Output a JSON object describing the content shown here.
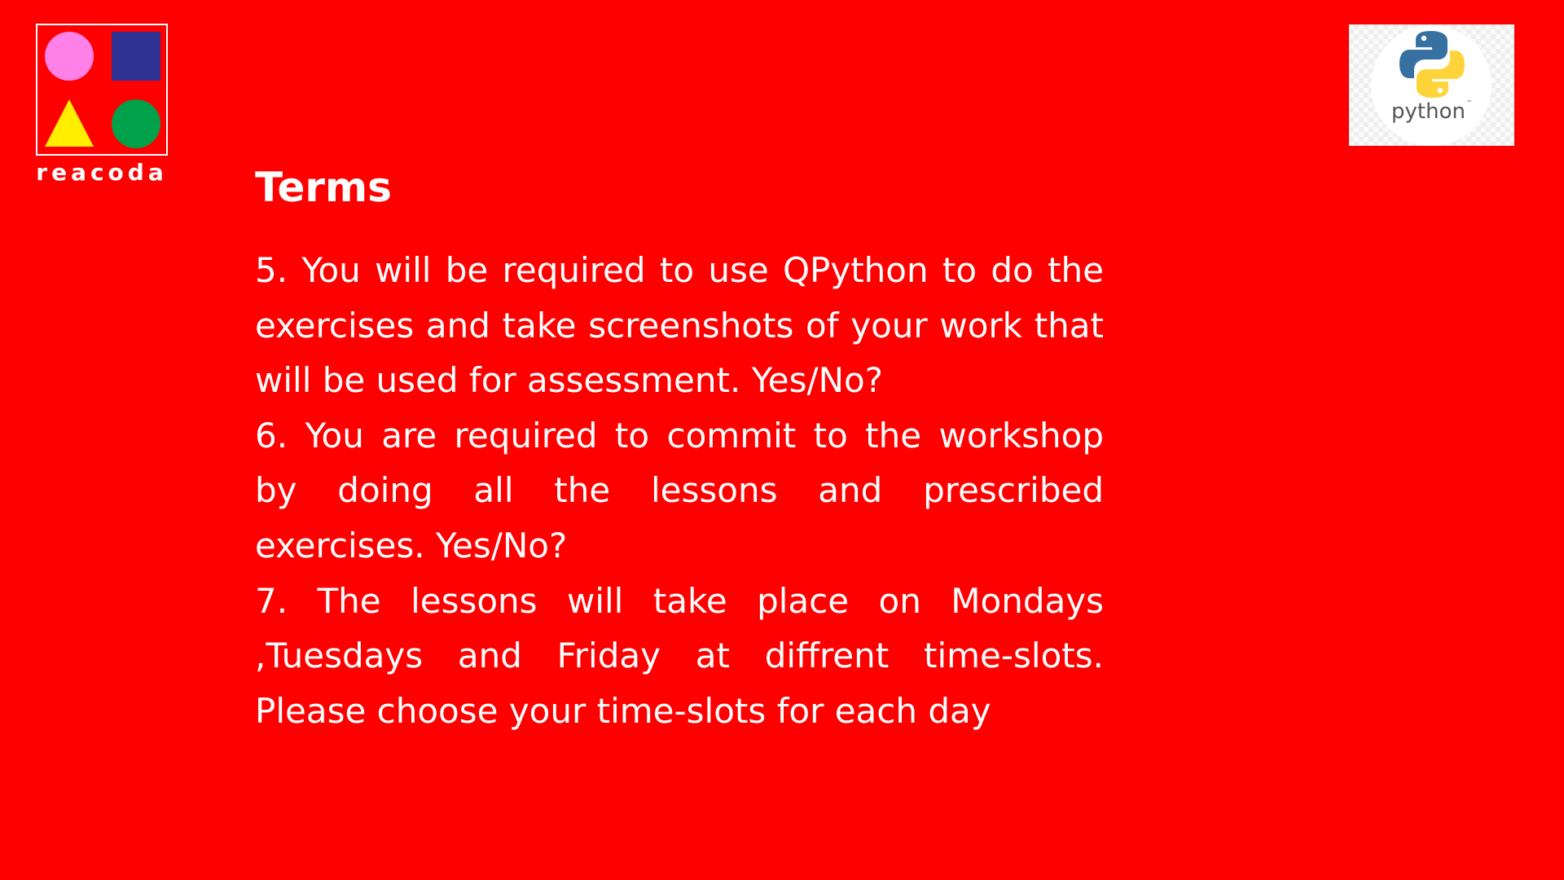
{
  "brand": {
    "name": "reacoda",
    "colors": {
      "pink": "#ff80e6",
      "blue": "#2e3192",
      "yellow": "#ffee00",
      "green": "#00a14b"
    }
  },
  "python_logo": {
    "wordmark": "python",
    "trademark": "™",
    "colors": {
      "blue": "#3771a1",
      "yellow": "#ffd43b"
    }
  },
  "slide": {
    "background": "#ff0000",
    "title": "Terms",
    "terms": [
      "5. You will be required to use QPython to do the exercises and take screenshots of your work that will be used for assessment. Yes/No?",
      "6. You are required to commit to the workshop by doing all the lessons and prescribed exercises. Yes/No?",
      "7. The lessons will take place on Mondays ,Tuesdays and Friday at diffrent time-slots. Please choose your time-slots for each day"
    ]
  }
}
